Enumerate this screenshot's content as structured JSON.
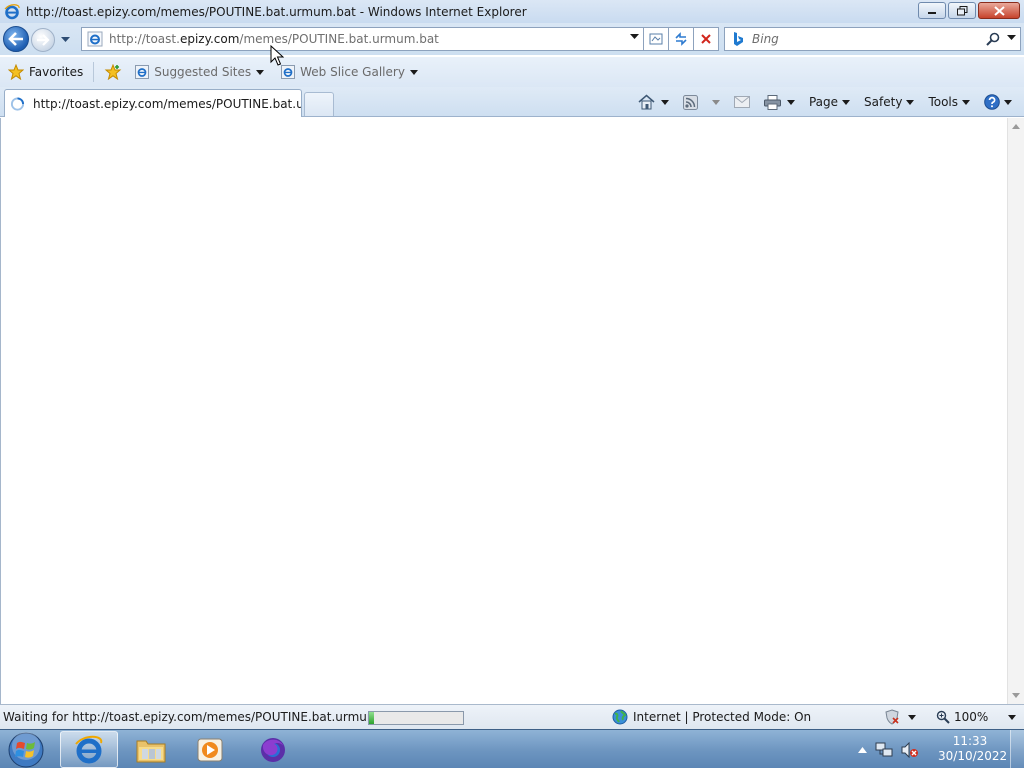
{
  "window": {
    "title": "http://toast.epizy.com/memes/POUTINE.bat.urmum.bat - Windows Internet Explorer"
  },
  "address_bar": {
    "url_prefix": "http://toast.",
    "url_domain": "epizy.com",
    "url_rest": "/memes/POUTINE.bat.urmum.bat"
  },
  "search": {
    "placeholder": "Bing"
  },
  "favorites_bar": {
    "favorites_label": "Favorites",
    "suggested_sites_label": "Suggested Sites",
    "web_slice_gallery_label": "Web Slice Gallery"
  },
  "tab": {
    "title": "http://toast.epizy.com/memes/POUTINE.bat.ur..."
  },
  "command_bar": {
    "page_label": "Page",
    "safety_label": "Safety",
    "tools_label": "Tools"
  },
  "status_bar": {
    "message": "Waiting for http://toast.epizy.com/memes/POUTINE.bat.urmum.bat",
    "progress_fraction": 0.05,
    "zone": "Internet | Protected Mode: On",
    "zoom": "100%"
  },
  "taskbar": {
    "time": "11:33",
    "date": "30/10/2022"
  },
  "icons": {
    "back": "back-arrow-icon",
    "forward": "forward-arrow-icon",
    "refresh": "refresh-icon",
    "stop": "stop-icon",
    "compatibility": "compatibility-view-icon",
    "search": "magnifier-icon",
    "home": "home-icon",
    "feeds": "rss-icon",
    "mail": "mail-icon",
    "print": "printer-icon",
    "help": "help-icon",
    "globe": "globe-icon"
  },
  "colors": {
    "accent": "#1e5eb2",
    "close_button": "#c7432c",
    "taskbar": "#6d95c0",
    "progress": "#2ea42e"
  }
}
